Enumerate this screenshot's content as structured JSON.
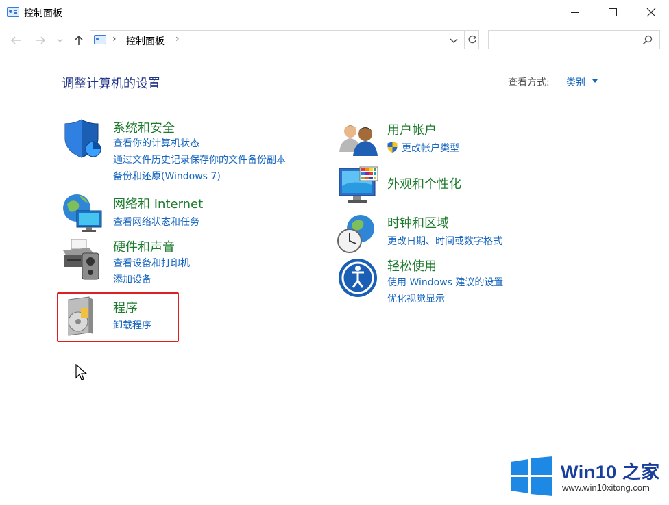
{
  "window": {
    "title": "控制面板"
  },
  "address": {
    "crumb": "控制面板",
    "search_placeholder": ""
  },
  "header": {
    "title": "调整计算机的设置",
    "view_by_label": "查看方式:",
    "view_by_value": "类别"
  },
  "categories_left": [
    {
      "title": "系统和安全",
      "links": [
        "查看你的计算机状态",
        "通过文件历史记录保存你的文件备份副本",
        "备份和还原(Windows 7)"
      ],
      "icon": "shield-icon"
    },
    {
      "title": "网络和 Internet",
      "links": [
        "查看网络状态和任务"
      ],
      "icon": "network-globe-icon"
    },
    {
      "title": "硬件和声音",
      "links": [
        "查看设备和打印机",
        "添加设备"
      ],
      "icon": "printer-speaker-icon"
    },
    {
      "title": "程序",
      "links": [
        "卸载程序"
      ],
      "icon": "programs-disc-icon"
    }
  ],
  "categories_right": [
    {
      "title": "用户帐户",
      "links": [
        "更改帐户类型"
      ],
      "icon": "users-icon"
    },
    {
      "title": "外观和个性化",
      "links": [],
      "icon": "monitor-palette-icon"
    },
    {
      "title": "时钟和区域",
      "links": [
        "更改日期、时间或数字格式"
      ],
      "icon": "clock-globe-icon"
    },
    {
      "title": "轻松使用",
      "links": [
        "使用 Windows 建议的设置",
        "优化视觉显示"
      ],
      "icon": "ease-of-access-icon"
    }
  ],
  "watermark": {
    "brand": "Win10 之家",
    "url": "www.win10xitong.com"
  },
  "colors": {
    "title_green": "#1b7a2b",
    "link_blue": "#1565c0",
    "heading_navy": "#1e3287",
    "highlight_red": "#e02020"
  }
}
